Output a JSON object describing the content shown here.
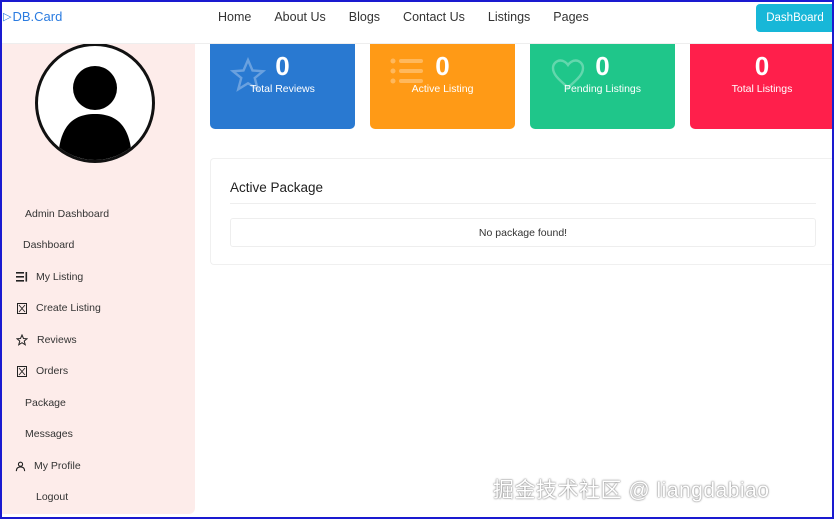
{
  "brand": {
    "name": "DB.Card"
  },
  "nav": {
    "links": [
      "Home",
      "About Us",
      "Blogs",
      "Contact Us",
      "Listings",
      "Pages"
    ],
    "dashboard_button": "DashBoard"
  },
  "sidebar": {
    "items": [
      {
        "label": "Admin Dashboard",
        "icon": ""
      },
      {
        "label": "Dashboard",
        "icon": ""
      },
      {
        "label": "My Listing",
        "icon": "list-icon"
      },
      {
        "label": "Create Listing",
        "icon": "hourglass-icon"
      },
      {
        "label": "Reviews",
        "icon": "star-icon"
      },
      {
        "label": "Orders",
        "icon": "hourglass-icon"
      },
      {
        "label": "Package",
        "icon": ""
      },
      {
        "label": "Messages",
        "icon": ""
      },
      {
        "label": "My Profile",
        "icon": "user-icon"
      },
      {
        "label": "Logout",
        "icon": ""
      }
    ]
  },
  "stats": [
    {
      "value": "0",
      "label": "Total Reviews",
      "color": "#2979d1",
      "icon": "star-icon"
    },
    {
      "value": "0",
      "label": "Active Listing",
      "color": "#ff9a16",
      "icon": "list-icon"
    },
    {
      "value": "0",
      "label": "Pending Listings",
      "color": "#1fc68a",
      "icon": "heart-icon"
    },
    {
      "value": "0",
      "label": "Total Listings",
      "color": "#ff1f4b",
      "icon": ""
    }
  ],
  "package": {
    "title": "Active Package",
    "empty_text": "No package found!"
  },
  "credit": "掘金技术社区 @ liangdabiao"
}
